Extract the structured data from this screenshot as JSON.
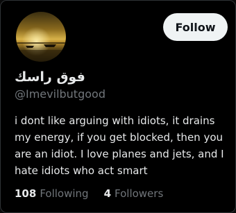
{
  "profile": {
    "display_name": "فوق راسك",
    "handle": "@Imevilbutgood",
    "bio": "i dont like arguing with idiots, it drains my energy, if you get blocked, then you are an idiot. I love planes and jets, and I hate idiots who act smart",
    "avatar_alt": "sunset-over-water-avatar"
  },
  "actions": {
    "follow_label": "Follow"
  },
  "stats": {
    "following_count": "108",
    "following_label": "Following",
    "followers_count": "4",
    "followers_label": "Followers"
  },
  "colors": {
    "background": "#000000",
    "primary_text": "#e7e9ea",
    "secondary_text": "#71767b",
    "follow_button_bg": "#eff3f4",
    "follow_button_text": "#0f1419"
  }
}
